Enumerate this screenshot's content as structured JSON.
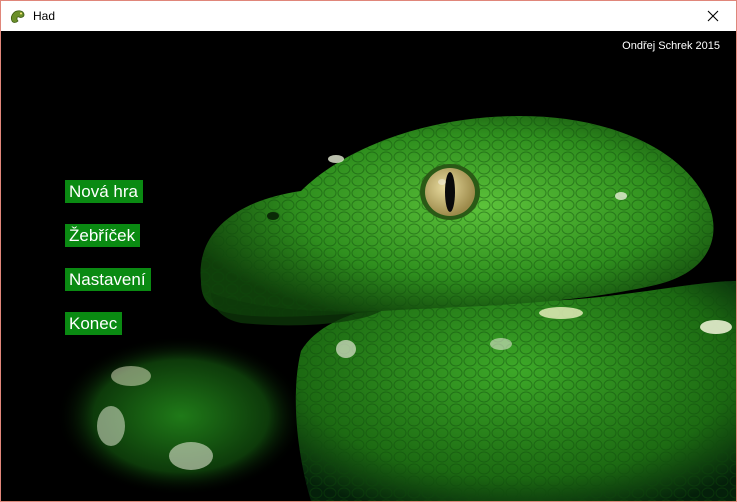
{
  "window": {
    "title": "Had",
    "app_icon": "snake-icon",
    "close_icon": "close-icon"
  },
  "credit": "Ondřej Schrek 2015",
  "menu": {
    "items": [
      {
        "label": "Nová hra"
      },
      {
        "label": "Žebříček"
      },
      {
        "label": "Nastavení"
      },
      {
        "label": "Konec"
      }
    ]
  },
  "colors": {
    "menu_bg": "#0a8a12",
    "background": "#000000",
    "snake": "#3fa82a",
    "border": "#e0867a"
  }
}
